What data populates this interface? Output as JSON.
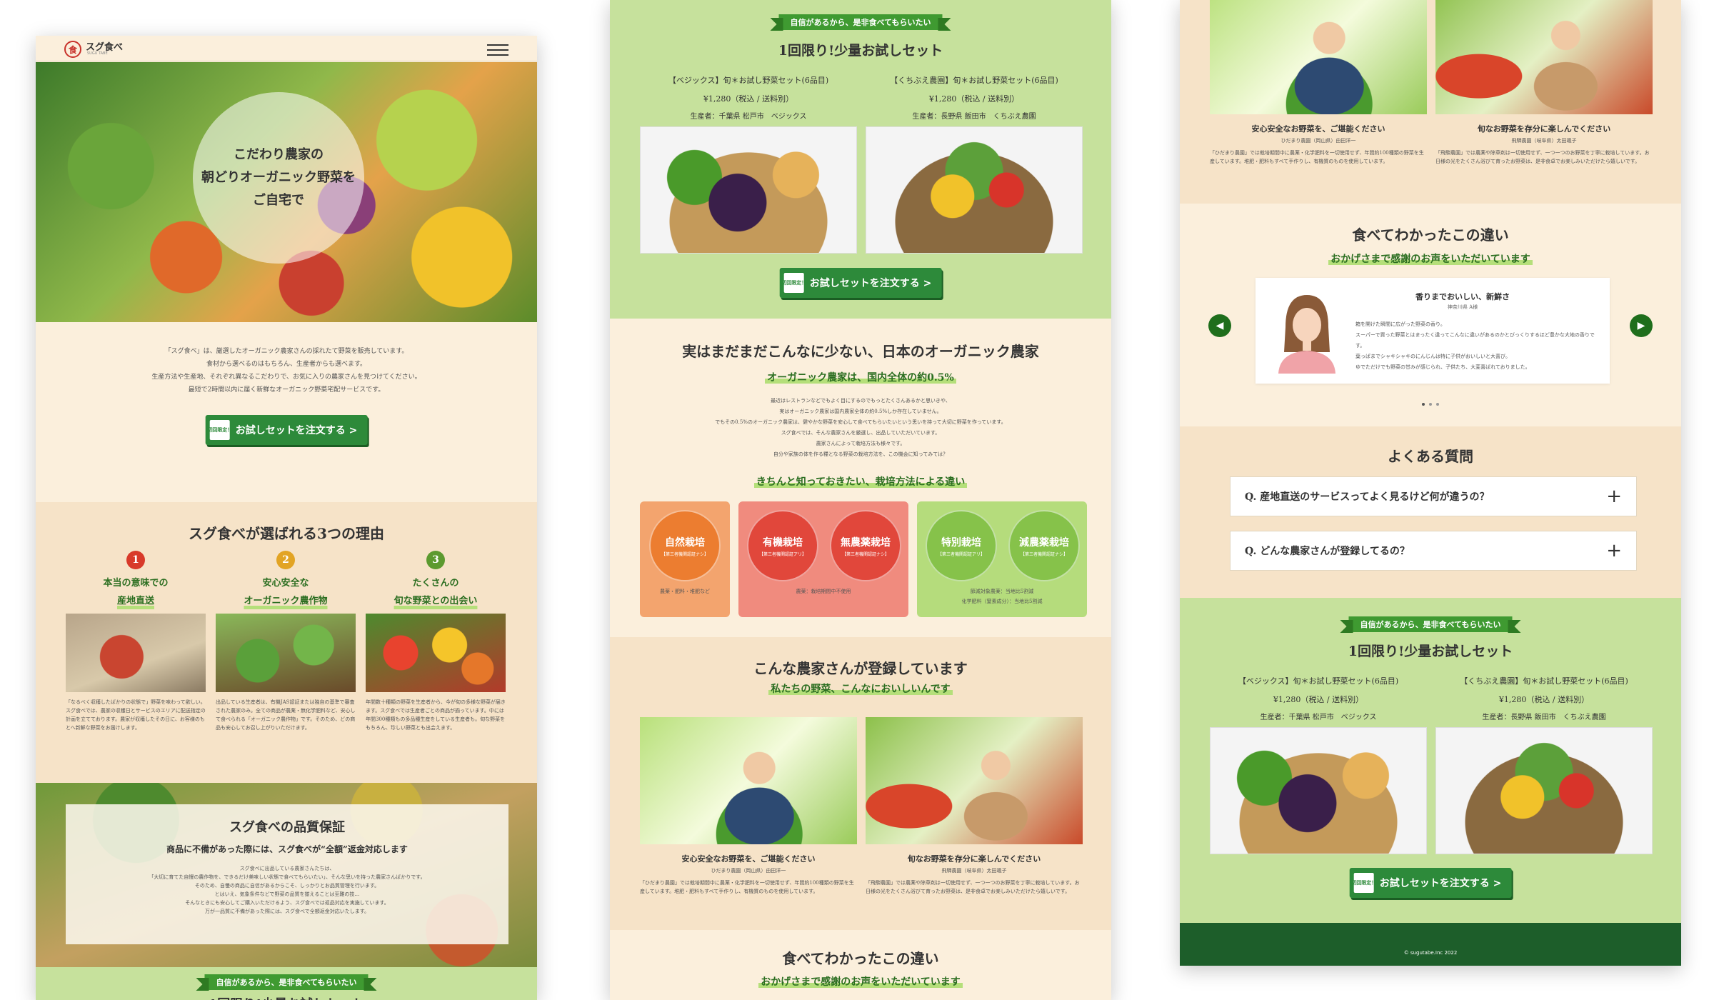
{
  "brand": {
    "name": "スグ食べ",
    "sub": "SUGU TABE"
  },
  "hero": {
    "line1": "こだわり農家の",
    "line2": "朝どりオーガニック野菜を",
    "line3": "ご自宅で"
  },
  "intro": {
    "line1": "「スグ食べ」は、厳選したオーガニック農家さんの採れたて野菜を販売しています。",
    "line2": "食材から選べるのはもちろん、生産者からも選べます。",
    "line3": "生産方法や生産地、それぞれ異なるこだわりで、お気に入りの農家さんを見つけてください。",
    "line4": "最短で2時間以内に届く新鮮なオーガニック野菜宅配サービスです。"
  },
  "cta": {
    "tag": "初回限定！",
    "label": "お試しセットを注文する >"
  },
  "reasons": {
    "title": "スグ食べが選ばれる3つの理由",
    "items": [
      {
        "num": "1",
        "line1": "本当の意味での",
        "line2": "産地直送",
        "text": "「なるべく収穫したばかりの状態で」野菜を味わって欲しい。スグ食べでは、農家の収穫日とサービスのエリアに配送指定の計画を立てております。農家が収穫したその日に、お客様のもとへ新鮮な野菜をお届けします。"
      },
      {
        "num": "2",
        "line1": "安心安全な",
        "line2": "オーガニック農作物",
        "text": "出品している生産者は、有機JAS認証または独自の基準で審査された農家のみ。全ての商品が農薬・無化学肥料など、安心して食べられる「オーガニック農作物」です。そのため、どの商品も安心してお召し上がりいただけます。"
      },
      {
        "num": "3",
        "line1": "たくさんの",
        "line2": "旬な野菜との出会い",
        "text": "年間数十種類の野菜を生産者から、今が旬の多様な野菜が届きます。スグ食べでは生産者ごとの商品が揃っています。中には年間300種類もの多品種生産をしている生産者も。旬な野菜をもちろん、珍しい野菜とも出会えます。"
      }
    ]
  },
  "guarantee": {
    "title": "スグ食べの品質保証",
    "sub": "商品に不備があった際には、スグ食べが“全額”返金対応します",
    "line1": "スグ食べに出品している農家さんたちは、",
    "line2": "「大切に育てた自慢の農作物を、できるだけ美味しい状態で食べてもらいたい」、そんな思いを持った農家さんばかりです。",
    "line3": "そのため、自慢の商品に自信があるからこそ、しっかりとお品質管理を行います。",
    "line4": "とはいえ、気象条件などで野菜の品質を揃えることは至難の技…",
    "line5": "そんなときにも安心してご購入いただけるよう、スグ食べでは返品対応を実施しています。",
    "line6": "万が一品質に不備があった際には、スグ食べで全額返金対応いたします。"
  },
  "trial": {
    "ribbon": "自信があるから、是非食べてもらいたい",
    "title": "1回限り!少量お試しセット",
    "items": [
      {
        "name": "【ベジックス】旬＊お試し野菜セット(6品目)",
        "price": "¥1,280（税込 / 送料別）",
        "producer": "生産者：千葉県 松戸市　ベジックス"
      },
      {
        "name": "【くちぶえ農園】旬＊お試し野菜セット(6品目)",
        "price": "¥1,280（税込 / 送料別）",
        "producer": "生産者：長野県 飯田市　くちぶえ農園"
      }
    ]
  },
  "organic": {
    "title": "実はまだまだこんなに少ない、日本のオーガニック農家",
    "highlight": "オーガニック農家は、国内全体の約0.5%",
    "line1": "最近はレストランなどでもよく目にするのでもっとたくさんあるかと思いきや、",
    "line2": "実はオーガニック農家は国内農家全体の約0.5%しか存在していません。",
    "line3": "でもその0.5%のオーガニック農家は、健やかな野菜を安心して食べてもらいたいという思いを持って大切に野菜を作っています。",
    "line4": "スグ食べでは、そんな農家さんを厳選し、出品していただいています。",
    "line5": "農家さんによって栽培方法も様々です。",
    "line6": "自分や家族の体を作る糧となる野菜の栽培方法を、この機会に知ってみては？"
  },
  "methods": {
    "heading": "きちんと知っておきたい、栽培方法による違い",
    "groups": [
      {
        "circles": [
          {
            "name": "自然栽培",
            "sub": "【第三者機関認証ナシ】"
          }
        ],
        "note1": "農薬・肥料・堆肥など",
        "note2": ""
      },
      {
        "circles": [
          {
            "name": "有機栽培",
            "sub": "【第三者機関認証アリ】"
          },
          {
            "name": "無農薬栽培",
            "sub": "【第三者機関認証ナシ】"
          }
        ],
        "note1": "農薬：栽培期間中不使用",
        "note2": ""
      },
      {
        "circles": [
          {
            "name": "特別栽培",
            "sub": "【第三者機関認証アリ】"
          },
          {
            "name": "減農薬栽培",
            "sub": "【第三者機関認証ナシ】"
          }
        ],
        "note1": "節減対象農薬：当地比5割減",
        "note2": "化学肥料（窒素成分）：当地比5割減"
      }
    ]
  },
  "farmers": {
    "title": "こんな農家さんが登録しています",
    "highlight": "私たちの野菜、こんなにおいしいんです",
    "items": [
      {
        "catch": "安心安全なお野菜を、ご堪能ください",
        "name": "ひだまり農園（岡山県）由田洋一",
        "text": "「ひだまり農園」では栽培期間中に農薬・化学肥料を一切使用せず、年間約100種類の野菜を生産しています。堆肥・肥料もすべて手作りし、有機質のものを使用しています。"
      },
      {
        "catch": "旬なお野菜を存分に楽しんでください",
        "name": "飛騨農園（岐阜県）太田颯子",
        "text": "「飛騨農園」では農薬や除草剤は一切使用せず、一つ一つのお野菜を丁寧に栽培しています。お日様の光をたくさん浴びて育ったお野菜は、是非食卓でお楽しみいただけたら嬉しいです。"
      }
    ]
  },
  "voices": {
    "title": "食べてわかったこの違い",
    "highlight": "おかげさまで感謝のお声をいただいています",
    "card_title": "香りまでおいしい、新鮮さ",
    "card_author": "神奈川県 A様",
    "line1": "箱を開けた瞬間に広がった野菜の香り。",
    "line2": "スーパーで買った野菜とはまったく違ってこんなに違いがあるのかとびっくりするほど豊かな大地の香りです。",
    "line3": "葉っぱまでシャキシャキのにんじんは特に子供がおいしいと大喜び。",
    "line4": "ゆでただけでも野菜の甘みが感じられ、子供たち、大変喜ばれておりました。"
  },
  "faq": {
    "title": "よくある質問",
    "items": [
      {
        "q": "Q. 産地直送のサービスってよく見るけど何が違うの？"
      },
      {
        "q": "Q. どんな農家さんが登録してるの？"
      }
    ]
  },
  "footer": {
    "copyright": "© sugutabe.Inc 2022"
  }
}
